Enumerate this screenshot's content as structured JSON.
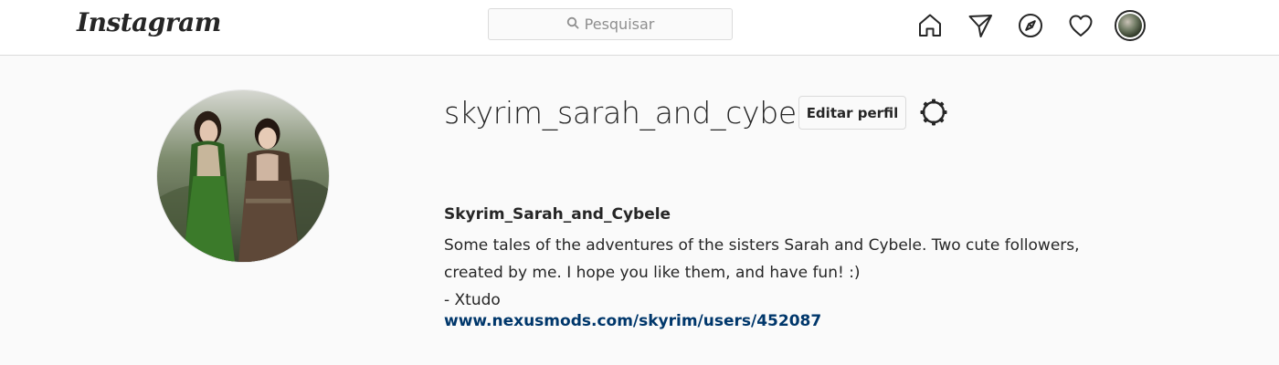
{
  "header": {
    "logo": "Instagram",
    "search_placeholder": "Pesquisar",
    "icons": [
      "home-icon",
      "direct-messages-icon",
      "explore-icon",
      "activity-heart-icon",
      "profile-avatar"
    ]
  },
  "profile": {
    "username": "skyrim_sarah_and_cybele",
    "edit_label": "Editar perfil",
    "full_name": "Skyrim_Sarah_and_Cybele",
    "bio_lines": [
      "Some tales of the adventures of the sisters Sarah and Cybele. Two cute followers,",
      "created by me. I hope you like them, and have fun! :)",
      "- Xtudo"
    ],
    "website": "www.nexusmods.com/skyrim/users/452087"
  },
  "colors": {
    "link": "#00376b",
    "border": "#dbdbdb",
    "background": "#fafafa"
  }
}
